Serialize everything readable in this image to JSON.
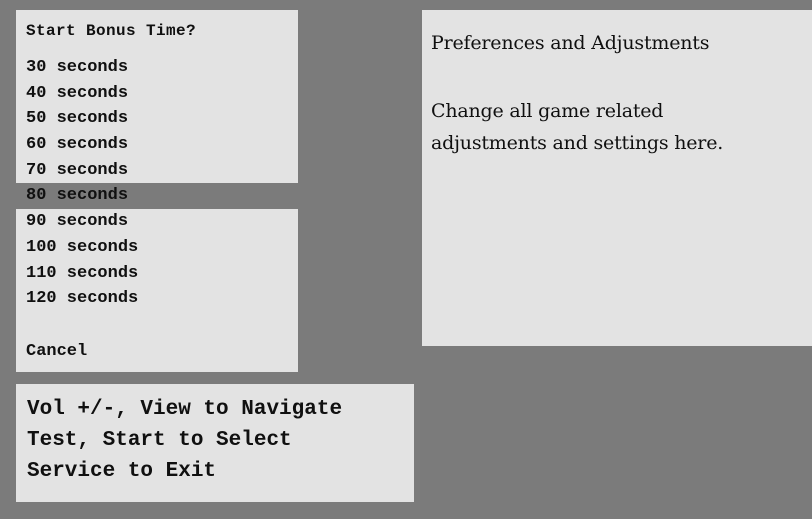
{
  "menu": {
    "title": "Start Bonus Time?",
    "options": [
      "30 seconds",
      "40 seconds",
      "50 seconds",
      "60 seconds",
      "70 seconds",
      "80 seconds",
      "90 seconds",
      "100 seconds",
      "110 seconds",
      "120 seconds"
    ],
    "selected_option": "80 seconds",
    "cancel_label": "Cancel"
  },
  "hints": {
    "line1": "Vol +/-, View to Navigate",
    "line2": "Test, Start to Select",
    "line3": "Service to Exit"
  },
  "info": {
    "title": "Preferences and Adjustments",
    "line1": "Change all game related",
    "line2": "adjustments and settings here."
  },
  "colors": {
    "background": "#7b7b7b",
    "panel": "#e3e3e3",
    "selection": "#7b7b7b",
    "text": "#101010"
  }
}
